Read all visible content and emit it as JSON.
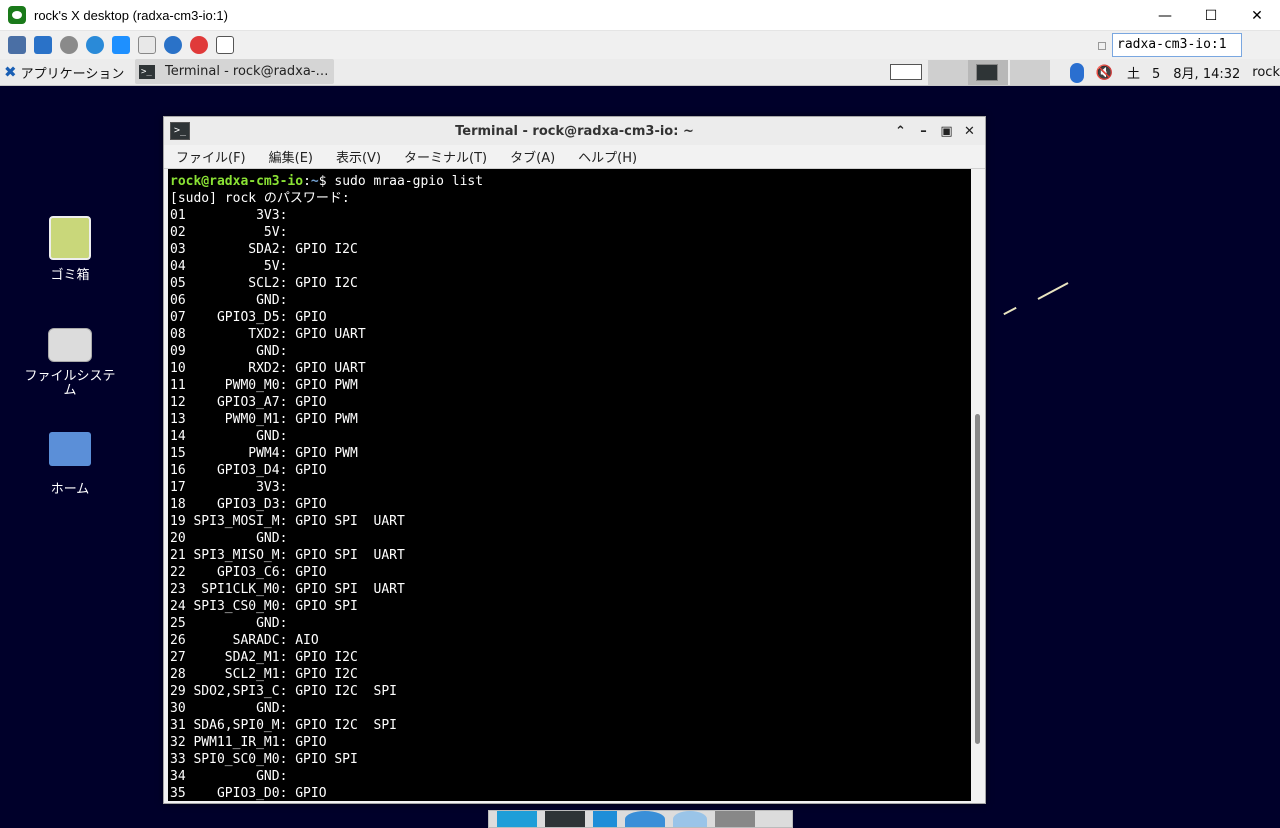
{
  "vnc": {
    "title": "rock's X desktop (radxa-cm3-io:1)",
    "host": "radxa-cm3-io:1",
    "controls": {
      "minimize": "—",
      "maximize": "☐",
      "close": "✕"
    }
  },
  "panel": {
    "menu_label": "アプリケーション",
    "task_label": "Terminal - rock@radxa-…",
    "tray": {
      "day": "土",
      "date": "5　8月, 14:32",
      "user": "rock"
    }
  },
  "desktop_icons": [
    {
      "label": "ゴミ箱"
    },
    {
      "label": "ファイルシステム"
    },
    {
      "label": "ホーム"
    }
  ],
  "terminal": {
    "title": "Terminal - rock@radxa-cm3-io: ~",
    "menu": [
      "ファイル(F)",
      "編集(E)",
      "表示(V)",
      "ターミナル(T)",
      "タブ(A)",
      "ヘルプ(H)"
    ],
    "prompt_user": "rock@radxa-cm3-io",
    "prompt_sep": ":",
    "prompt_path": "~",
    "prompt_cmd": "$ sudo mraa-gpio list",
    "lines": [
      "[sudo] rock のパスワード:",
      "01         3V3:",
      "02          5V:",
      "03        SDA2: GPIO I2C",
      "04          5V:",
      "05        SCL2: GPIO I2C",
      "06         GND:",
      "07    GPIO3_D5: GPIO",
      "08        TXD2: GPIO UART",
      "09         GND:",
      "10        RXD2: GPIO UART",
      "11     PWM0_M0: GPIO PWM",
      "12    GPIO3_A7: GPIO",
      "13     PWM0_M1: GPIO PWM",
      "14         GND:",
      "15        PWM4: GPIO PWM",
      "16    GPIO3_D4: GPIO",
      "17         3V3:",
      "18    GPIO3_D3: GPIO",
      "19 SPI3_MOSI_M: GPIO SPI  UART",
      "20         GND:",
      "21 SPI3_MISO_M: GPIO SPI  UART",
      "22    GPIO3_C6: GPIO",
      "23  SPI1CLK_M0: GPIO SPI  UART",
      "24 SPI3_CS0_M0: GPIO SPI",
      "25         GND:",
      "26      SARADC: AIO",
      "27     SDA2_M1: GPIO I2C",
      "28     SCL2_M1: GPIO I2C",
      "29 SDO2,SPI3_C: GPIO I2C  SPI",
      "30         GND:",
      "31 SDA6,SPI0_M: GPIO I2C  SPI",
      "32 PWM11_IR_M1: GPIO",
      "33 SPI0_SC0_M0: GPIO SPI",
      "34         GND:",
      "35    GPIO3_D0: GPIO"
    ]
  }
}
